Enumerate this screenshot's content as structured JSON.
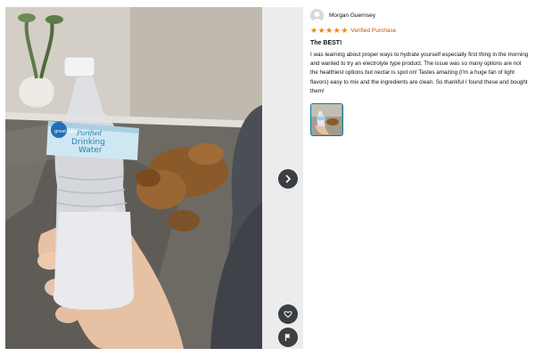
{
  "review": {
    "reviewer_name": "Morgan Guernsey",
    "rating": 5,
    "max_rating": 5,
    "verified_label": "Verified Purchase",
    "headline": "The BEST!",
    "body": "I was learning about proper ways to hydrate yourself especially first thing in the morning and wanted to try an electrolyte type product. The issue was so many options are not the healthiest options but nectar is spot on! Tastes amazing (I'm a huge fan of light flavors) easy to mix and the ingredients are clean. So thankful I found these and bought them!"
  },
  "photo": {
    "bottle_label_line1": "Purified",
    "bottle_label_line2": "Drinking",
    "bottle_label_line3": "Water",
    "bottle_brand": "great value"
  },
  "icons": {
    "next": "chevron-right-icon",
    "like": "heart-icon",
    "report": "flag-icon",
    "star": "star-icon",
    "avatar": "person-icon"
  },
  "colors": {
    "star": "#f08804",
    "verified": "#c45500",
    "thumb_border": "#008296",
    "button_bg": "#3a3f44"
  }
}
